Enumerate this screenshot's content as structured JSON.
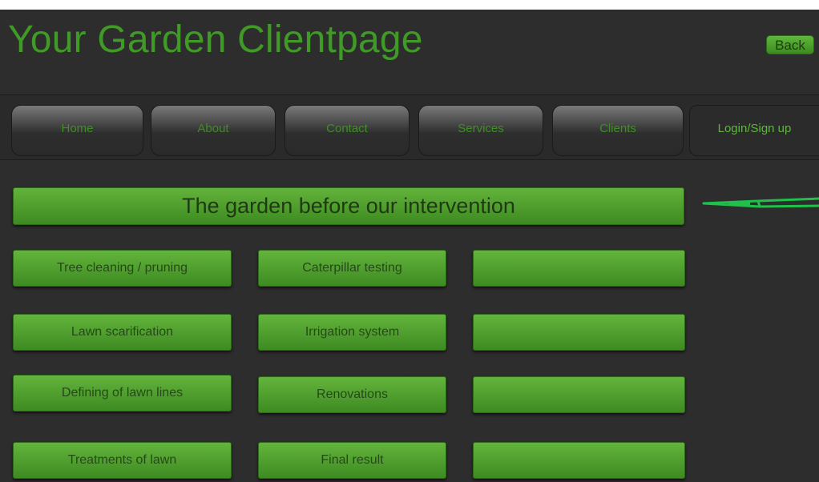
{
  "header": {
    "title": "Your Garden Clientpage",
    "back_label": "Back"
  },
  "nav": {
    "tabs": [
      {
        "label": "Home"
      },
      {
        "label": "About"
      },
      {
        "label": "Contact"
      },
      {
        "label": "Services"
      },
      {
        "label": "Clients"
      }
    ],
    "login_label": "Login/Sign up"
  },
  "main": {
    "banner": "The garden before our intervention",
    "rows": [
      {
        "col1": "Tree cleaning / pruning",
        "col2": "Caterpillar testing",
        "col3": ""
      },
      {
        "col1": "Lawn scarification",
        "col2": "Irrigation system",
        "col3": ""
      },
      {
        "col1": "Defining of lawn lines",
        "col2": "Renovations",
        "col3": ""
      },
      {
        "col1": "Treatments of lawn",
        "col2": "Final result",
        "col3": ""
      }
    ]
  },
  "colors": {
    "background": "#2d2d2d",
    "title_green": "#3f9a26",
    "button_green": "#4fa02d",
    "annotation_arrow": "#1ec24a"
  },
  "icons": {
    "annotation": "arrow-left-icon"
  }
}
